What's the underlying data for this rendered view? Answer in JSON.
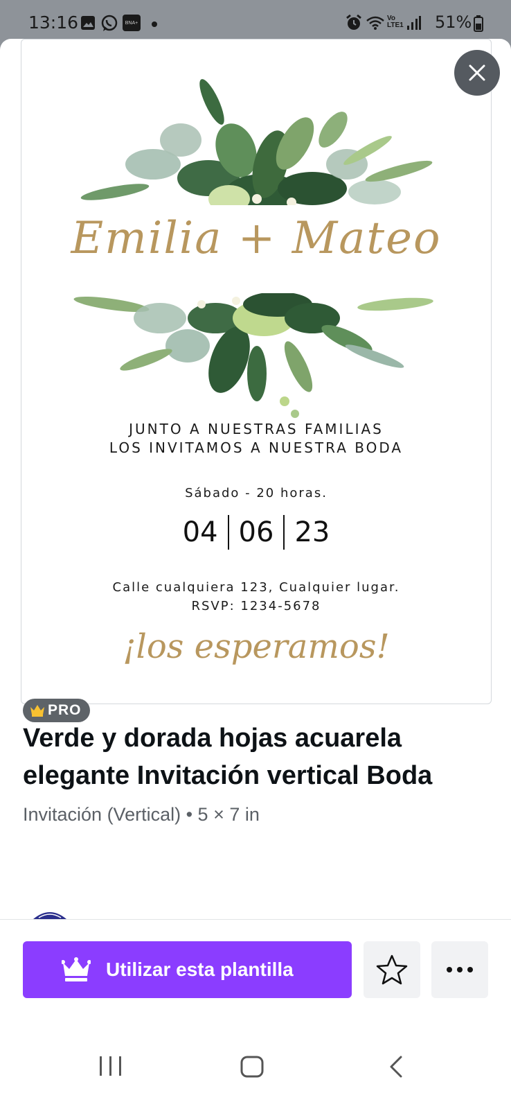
{
  "status_bar": {
    "time": "13:16",
    "battery": "51%",
    "notification_icons": [
      "gallery-icon",
      "whatsapp-icon",
      "bna-app-icon",
      "dot-icon"
    ],
    "system_icons": [
      "alarm-icon",
      "wifi-icon",
      "volte-icon",
      "signal-icon",
      "battery-icon"
    ],
    "bna_label": "BNA+",
    "volte_label": "Vo LTE1"
  },
  "template_preview": {
    "names": "Emilia + Mateo",
    "line1": "JUNTO A NUESTRAS FAMILIAS",
    "line2": "LOS INVITAMOS A NUESTRA BODA",
    "day_time": "Sábado - 20 horas.",
    "date": [
      "04",
      "06",
      "23"
    ],
    "address": "Calle cualquiera 123, Cualquier lugar.",
    "rsvp": "RSVP: 1234-5678",
    "closing": "¡los esperamos!"
  },
  "badge": {
    "label": "PRO"
  },
  "template_info": {
    "title": "Verde y dorada hojas acuarela elegante Invitación vertical Boda",
    "subtitle": "Invitación (Vertical) • 5 × 7 in"
  },
  "actions": {
    "use_template_label": "Utilizar esta plantilla"
  },
  "colors": {
    "accent": "#8b3dff",
    "gold": "#b8975e",
    "leaf_dark": "#2f5a36",
    "leaf_light": "#a9c98a"
  }
}
